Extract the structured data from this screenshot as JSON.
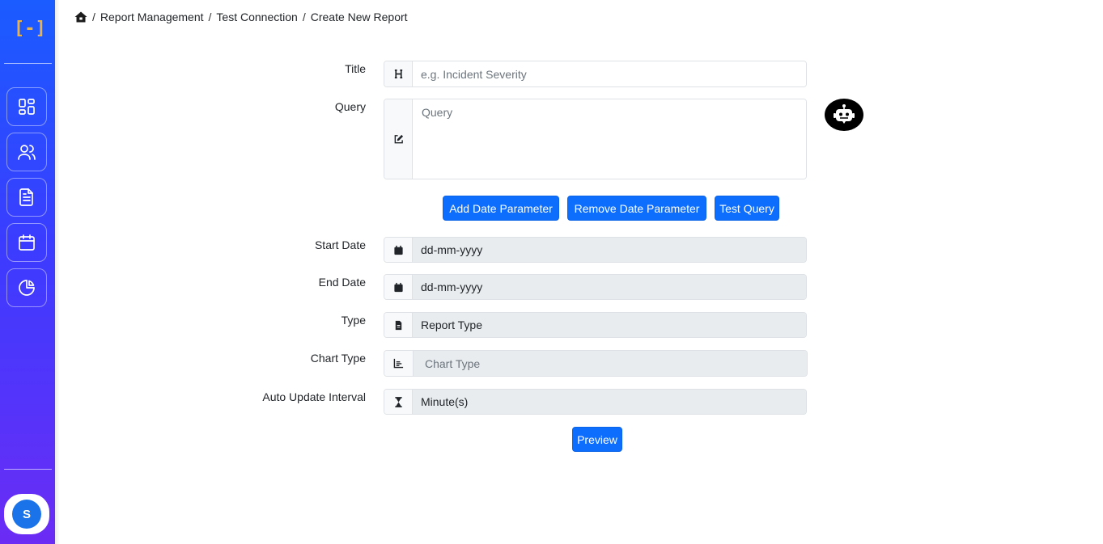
{
  "sidebar": {
    "logo": "[-]",
    "items": [
      {
        "name": "dashboard",
        "icon": "dashboard-grid-icon"
      },
      {
        "name": "users",
        "icon": "users-icon"
      },
      {
        "name": "reports",
        "icon": "document-icon"
      },
      {
        "name": "calendar",
        "icon": "calendar-icon"
      },
      {
        "name": "analytics",
        "icon": "pie-chart-icon"
      }
    ],
    "avatar_initial": "S"
  },
  "breadcrumb": {
    "home_icon": "home-icon",
    "items": [
      "Report Management",
      "Test Connection",
      "Create New Report"
    ],
    "separator": "/"
  },
  "form": {
    "title": {
      "label": "Title",
      "icon": "heading-icon",
      "placeholder": "e.g. Incident Severity"
    },
    "query": {
      "label": "Query",
      "icon": "edit-icon",
      "placeholder": "Query"
    },
    "buttons": {
      "add_date": "Add Date Parameter",
      "remove_date": "Remove Date Parameter",
      "test_query": "Test Query"
    },
    "start_date": {
      "label": "Start Date",
      "icon": "calendar-icon",
      "value": "dd-mm-yyyy"
    },
    "end_date": {
      "label": "End Date",
      "icon": "calendar-icon",
      "value": "dd-mm-yyyy"
    },
    "type": {
      "label": "Type",
      "icon": "file-icon",
      "value": "Report Type"
    },
    "chart_type": {
      "label": "Chart Type",
      "icon": "chart-icon",
      "placeholder": "Chart Type"
    },
    "auto_update": {
      "label": "Auto Update Interval",
      "icon": "hourglass-icon",
      "value": "Minute(s)"
    },
    "preview": "Preview"
  },
  "assistant": {
    "icon": "robot-icon"
  },
  "colors": {
    "primary": "#0d6efd",
    "sidebar_top": "#1a5cff",
    "sidebar_bottom": "#6b2cf5",
    "logo": "#e8b34a"
  }
}
